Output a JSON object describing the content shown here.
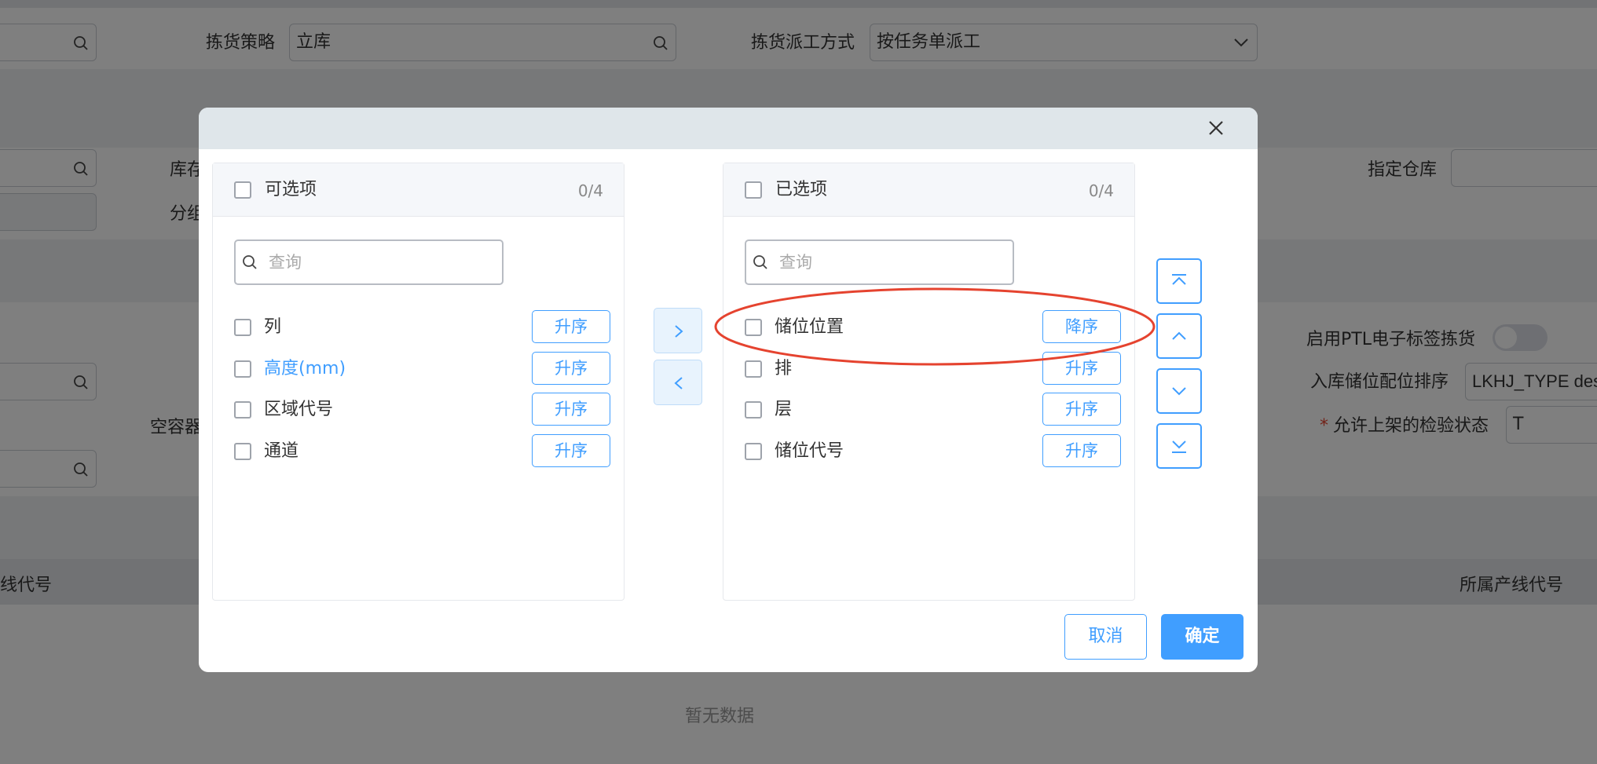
{
  "background": {
    "picking_strategy_label": "拣货策略",
    "picking_strategy_value": "立库",
    "dispatch_mode_label": "拣货派工方式",
    "dispatch_mode_value": "按任务单派工",
    "stock_label_partial": "库存",
    "group_label_partial": "分组",
    "designated_warehouse_label": "指定仓库",
    "empty_container_label_partial": "空容器",
    "enable_ptl_label": "启用PTL电子标签拣货",
    "inbound_sort_label": "入库储位配位排序",
    "inbound_sort_value": "LKHJ_TYPE des",
    "allowed_inspection_label": "允许上架的检验状态",
    "allowed_inspection_value": "T",
    "required_mark": "*",
    "table_header_left": "线代号",
    "table_header_right": "所属产线代号",
    "empty_text": "暂无数据"
  },
  "dialog": {
    "cancel_label": "取消",
    "confirm_label": "确定",
    "left_panel": {
      "title": "可选项",
      "count": "0/4",
      "search_placeholder": "查询",
      "items": [
        {
          "label": "列",
          "sort": "升序"
        },
        {
          "label": "高度(mm)",
          "sort": "升序"
        },
        {
          "label": "区域代号",
          "sort": "升序"
        },
        {
          "label": "通道",
          "sort": "升序"
        }
      ]
    },
    "right_panel": {
      "title": "已选项",
      "count": "0/4",
      "search_placeholder": "查询",
      "items": [
        {
          "label": "储位位置",
          "sort": "降序"
        },
        {
          "label": "排",
          "sort": "升序"
        },
        {
          "label": "层",
          "sort": "升序"
        },
        {
          "label": "储位代号",
          "sort": "升序"
        }
      ]
    },
    "colors": {
      "accent": "#409eff",
      "highlight_ellipse": "#e5432f",
      "header_bg": "#dfe6ea"
    }
  }
}
